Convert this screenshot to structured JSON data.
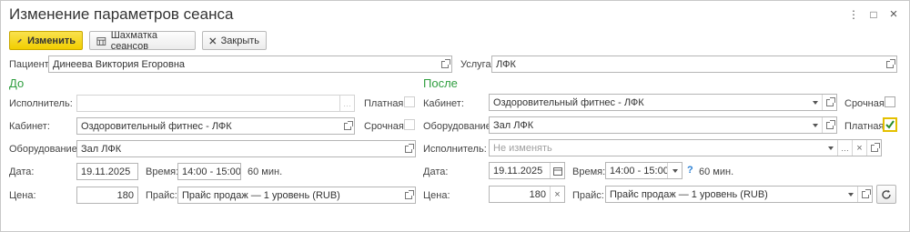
{
  "window": {
    "title": "Изменение параметров сеанса",
    "more_icon": "⋮",
    "maximize_icon": "□",
    "close_icon": "×"
  },
  "toolbar": {
    "edit_label": "Изменить",
    "schedule_label": "Шахматка сеансов",
    "close_label": "Закрыть"
  },
  "header": {
    "patient_label": "Пациент:",
    "patient_value": "Динеева Виктория Егоровна",
    "service_label": "Услуга:",
    "service_value": "ЛФК"
  },
  "before": {
    "section_title": "До",
    "executor_label": "Исполнитель:",
    "executor_value": "",
    "paid_label": "Платная:",
    "paid_checked": false,
    "room_label": "Кабинет:",
    "room_value": "Оздоровительный фитнес - ЛФК",
    "urgent_label": "Срочная:",
    "urgent_checked": false,
    "equipment_label": "Оборудование:",
    "equipment_value": "Зал ЛФК",
    "date_label": "Дата:",
    "date_value": "19.11.2025",
    "time_label": "Время:",
    "time_value": "14:00 - 15:00",
    "duration": "60 мин.",
    "price_label": "Цена:",
    "price_value": "180",
    "pricelist_label": "Прайс:",
    "pricelist_value": "Прайс продаж — 1 уровень (RUB)"
  },
  "after": {
    "section_title": "После",
    "room_label": "Кабинет:",
    "room_value": "Оздоровительный фитнес - ЛФК",
    "urgent_label": "Срочная:",
    "urgent_checked": false,
    "equipment_label": "Оборудование:",
    "equipment_value": "Зал ЛФК",
    "paid_label": "Платная:",
    "paid_checked": true,
    "executor_label": "Исполнитель:",
    "executor_placeholder": "Не изменять",
    "date_label": "Дата:",
    "date_value": "19.11.2025",
    "time_label": "Время:",
    "time_value": "14:00 - 15:00",
    "help_mark": "?",
    "duration": "60 мин.",
    "price_label": "Цена:",
    "price_value": "180",
    "pricelist_label": "Прайс:",
    "pricelist_value": "Прайс продаж — 1 уровень (RUB)"
  },
  "colors": {
    "accent": "#f2cf00",
    "section_green": "#2f9e3f",
    "help_blue": "#2a7fd4"
  }
}
